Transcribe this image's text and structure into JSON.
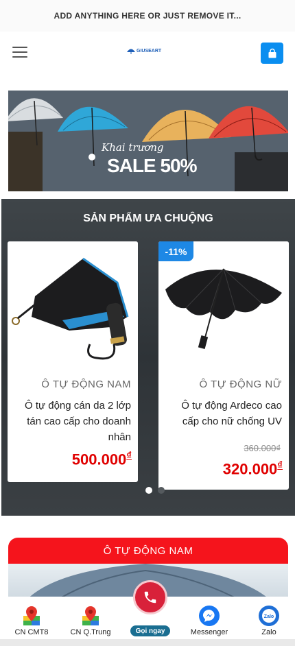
{
  "topbar": {
    "text": "ADD ANYTHING HERE OR JUST REMOVE IT..."
  },
  "header": {
    "logo_text": "GIUSEART",
    "menu_icon": "hamburger-icon",
    "cart_icon": "shopping-bag-icon",
    "accent": "#0a8ef0"
  },
  "banner": {
    "script_text": "Khai trương",
    "sale_text": "SALE 50%"
  },
  "popular": {
    "title": "SẢN PHẨM ƯA CHUỘNG",
    "products": [
      {
        "category": "Ô TỰ ĐỘNG NAM",
        "name": "Ô tự động cán da 2 lớp tán cao cấp cho doanh nhân",
        "price": "500.000",
        "currency": "₫"
      },
      {
        "badge": "-11%",
        "category": "Ô TỰ ĐỘNG NỮ",
        "name": "Ô tự động Ardeco cao cấp cho nữ chống UV",
        "old_price": "360.000₫",
        "price": "320.000",
        "currency": "₫"
      }
    ],
    "dots": {
      "count": 2,
      "active": 1
    }
  },
  "section": {
    "title": "Ô TỰ ĐỘNG NAM",
    "color": "#f5141c"
  },
  "bottom_nav": {
    "items": [
      {
        "label": "CN CMT8",
        "icon": "map-pin-icon"
      },
      {
        "label": "CN Q.Trung",
        "icon": "map-pin-icon"
      },
      {
        "label": "Gọi ngay",
        "icon": "phone-icon"
      },
      {
        "label": "Messenger",
        "icon": "messenger-icon"
      },
      {
        "label": "Zalo",
        "icon": "zalo-icon"
      }
    ]
  }
}
